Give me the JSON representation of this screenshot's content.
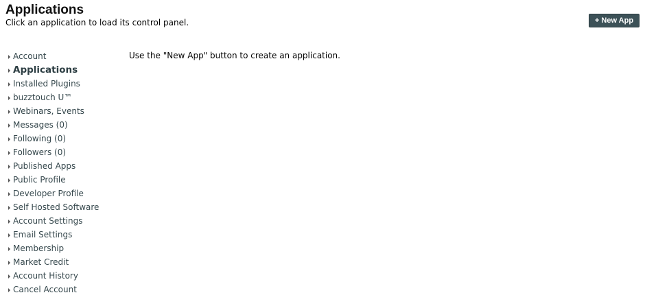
{
  "header": {
    "title": "Applications",
    "subtitle": "Click an application to load its control panel.",
    "new_app_label": "+ New App"
  },
  "sidebar": {
    "items": [
      {
        "label": "Account",
        "active": false
      },
      {
        "label": "Applications",
        "active": true
      },
      {
        "label": "Installed Plugins",
        "active": false
      },
      {
        "label": "buzztouch U™",
        "active": false
      },
      {
        "label": "Webinars, Events",
        "active": false
      },
      {
        "label": "Messages (0)",
        "active": false
      },
      {
        "label": "Following (0)",
        "active": false
      },
      {
        "label": "Followers (0)",
        "active": false
      },
      {
        "label": "Published Apps",
        "active": false
      },
      {
        "label": "Public Profile",
        "active": false
      },
      {
        "label": "Developer Profile",
        "active": false
      },
      {
        "label": "Self Hosted Software",
        "active": false
      },
      {
        "label": "Account Settings",
        "active": false
      },
      {
        "label": "Email Settings",
        "active": false
      },
      {
        "label": "Membership",
        "active": false
      },
      {
        "label": "Market Credit",
        "active": false
      },
      {
        "label": "Account History",
        "active": false
      },
      {
        "label": "Cancel Account",
        "active": false
      }
    ]
  },
  "main": {
    "message": "Use the \"New App\" button to create an application."
  },
  "colors": {
    "button_bg": "#3c5157",
    "link": "#36484d"
  }
}
